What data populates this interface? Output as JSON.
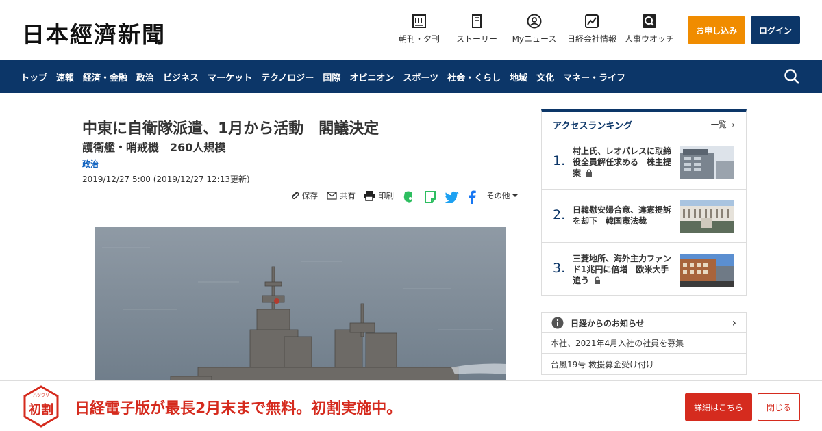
{
  "header": {
    "logo": "日本經濟新聞",
    "nav_items": [
      "朝刊・夕刊",
      "ストーリー",
      "Myニュース",
      "日経会社情報",
      "人事ウオッチ"
    ],
    "apply_label": "お申し込み",
    "login_label": "ログイン",
    "accent_orange": "#f08c00",
    "brand_navy": "#0c3668"
  },
  "nav": {
    "items": [
      "トップ",
      "速報",
      "経済・金融",
      "政治",
      "ビジネス",
      "マーケット",
      "テクノロジー",
      "国際",
      "オピニオン",
      "スポーツ",
      "社会・くらし",
      "地域",
      "文化",
      "マネー・ライフ"
    ]
  },
  "article": {
    "headline": "中東に自衛隊派遣、1月から活動　閣議決定",
    "subhead": "護衛艦・哨戒機　260人規模",
    "category": "政治",
    "date": "2019/12/27 5:00 (2019/12/27 12:13更新)",
    "tools": {
      "save": "保存",
      "share": "共有",
      "print": "印刷",
      "more": "その他"
    }
  },
  "ranking": {
    "title": "アクセスランキング",
    "all_label": "一覧",
    "items": [
      {
        "rank": "1.",
        "text": "村上氏、レオパレスに取締役全員解任求める　株主提案",
        "locked": true
      },
      {
        "rank": "2.",
        "text": "日韓慰安婦合意、違憲提訴を却下　韓国憲法裁",
        "locked": false
      },
      {
        "rank": "3.",
        "text": "三菱地所、海外主力ファンド1兆円に倍増　欧米大手追う",
        "locked": true
      }
    ]
  },
  "notices": {
    "title": "日経からのお知らせ",
    "items": [
      "本社、2021年4月入社の社員を募集",
      "台風19号 救援募金受け付け"
    ]
  },
  "banner": {
    "badge_top": "ハツワリ",
    "badge_text": "初割",
    "text": "日経電子版が最長2月末まで無料。初割実施中。",
    "detail_label": "詳細はこちら",
    "close_label": "閉じる",
    "accent_red": "#d52b1e"
  }
}
